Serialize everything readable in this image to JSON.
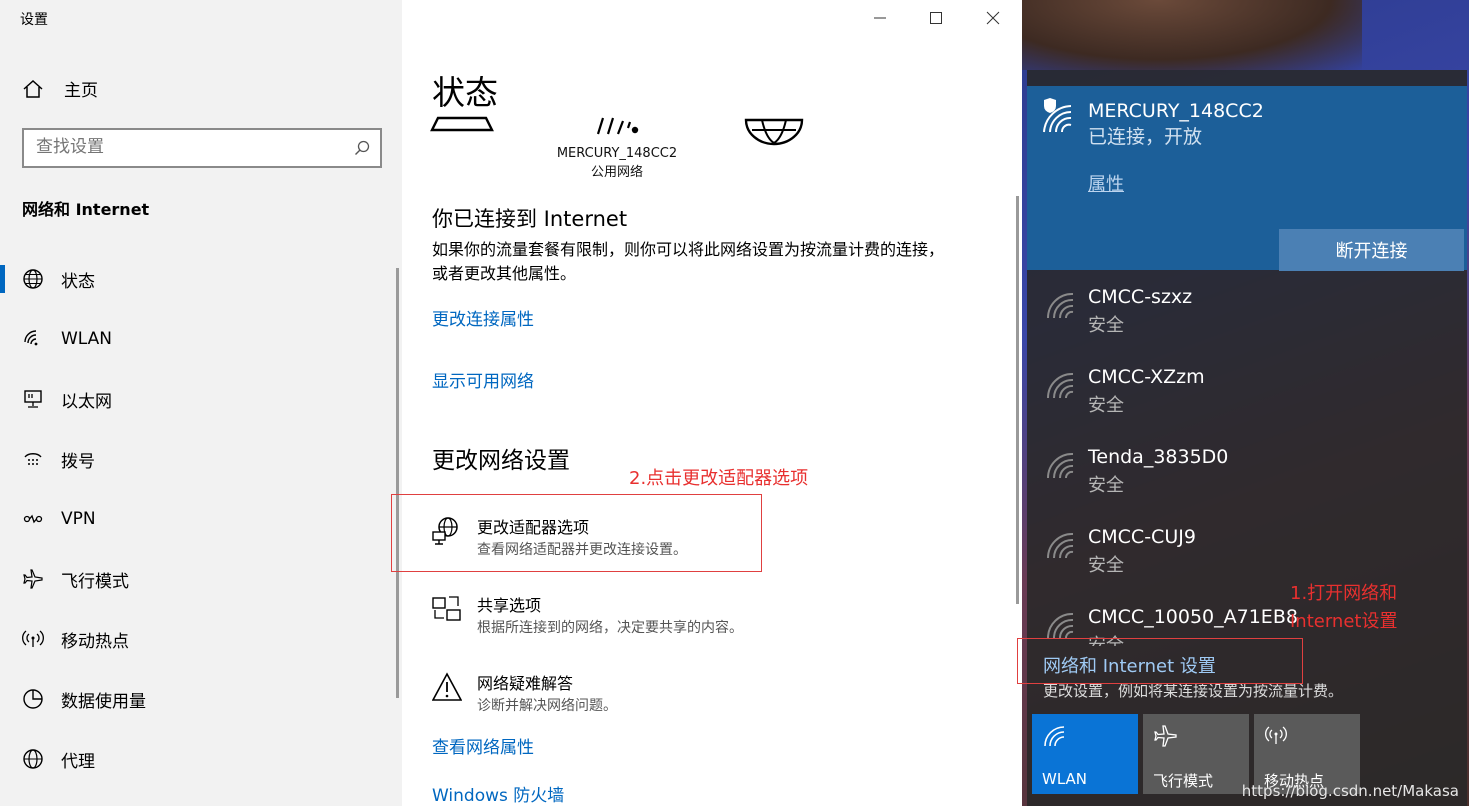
{
  "window": {
    "title": "设置"
  },
  "sidebar": {
    "home_label": "主页",
    "search_placeholder": "查找设置",
    "section_title": "网络和 Internet",
    "items": [
      {
        "label": "状态",
        "icon": "globe-icon"
      },
      {
        "label": "WLAN",
        "icon": "wifi-icon"
      },
      {
        "label": "以太网",
        "icon": "ethernet-icon"
      },
      {
        "label": "拨号",
        "icon": "dialup-icon"
      },
      {
        "label": "VPN",
        "icon": "vpn-icon"
      },
      {
        "label": "飞行模式",
        "icon": "airplane-icon"
      },
      {
        "label": "移动热点",
        "icon": "hotspot-icon"
      },
      {
        "label": "数据使用量",
        "icon": "data-usage-icon"
      },
      {
        "label": "代理",
        "icon": "proxy-globe-icon"
      }
    ]
  },
  "main": {
    "title": "状态",
    "network_name": "MERCURY_148CC2",
    "network_type": "公用网络",
    "connected_heading": "你已连接到 Internet",
    "connected_desc": "如果你的流量套餐有限制，则你可以将此网络设置为按流量计费的连接，或者更改其他属性。",
    "link_change_props": "更改连接属性",
    "link_show_networks": "显示可用网络",
    "change_heading": "更改网络设置",
    "options": [
      {
        "title": "更改适配器选项",
        "desc": "查看网络适配器并更改连接设置。"
      },
      {
        "title": "共享选项",
        "desc": "根据所连接到的网络，决定要共享的内容。"
      },
      {
        "title": "网络疑难解答",
        "desc": "诊断并解决网络问题。"
      }
    ],
    "link_view_props": "查看网络属性",
    "link_firewall": "Windows 防火墙"
  },
  "annotations": {
    "step2": "2.点击更改适配器选项",
    "step1_line1": "1.打开网络和",
    "step1_line2": "Internet设置"
  },
  "flyout": {
    "connected": {
      "name": "MERCURY_148CC2",
      "status": "已连接，开放",
      "properties": "属性",
      "disconnect": "断开连接"
    },
    "networks": [
      {
        "name": "CMCC-szxz",
        "status": "安全"
      },
      {
        "name": "CMCC-XZzm",
        "status": "安全"
      },
      {
        "name": "Tenda_3835D0",
        "status": "安全"
      },
      {
        "name": "CMCC-CUJ9",
        "status": "安全"
      },
      {
        "name": "CMCC_10050_A71EB8",
        "status": "安全"
      }
    ],
    "settings_link": "网络和 Internet 设置",
    "settings_desc": "更改设置，例如将某连接设置为按流量计费。",
    "quick_actions": [
      {
        "label": "WLAN",
        "color": "#0a74d6"
      },
      {
        "label": "飞行模式",
        "color": "#5a5a5a"
      },
      {
        "label": "移动热点",
        "color": "#5a5a5a"
      }
    ]
  },
  "watermark": "https://blog.csdn.net/Makasa",
  "colors": {
    "accent": "#0067c0",
    "annotation_red": "#e8302f",
    "flyout_card": "#1c5f99"
  }
}
